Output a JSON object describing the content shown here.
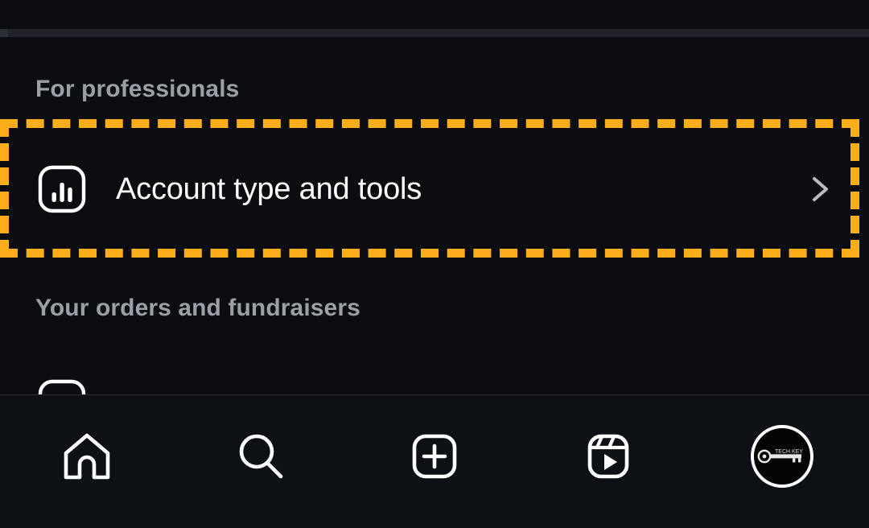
{
  "app": {
    "theme": "dark",
    "background_color": "#0b0d10",
    "accent_highlight_color": "#FBAD1B"
  },
  "sections": [
    {
      "heading": "For professionals"
    },
    {
      "heading": "Your orders and fundraisers"
    }
  ],
  "highlighted_row": {
    "label": "Account type and tools",
    "icon": "bar-chart-icon",
    "chevron": "chevron-right-icon",
    "annotation": {
      "style": "dashed-rectangle",
      "color": "#FBAD1B"
    }
  },
  "bottom_nav": {
    "items": [
      {
        "name": "home",
        "icon": "home-icon",
        "label": "Home"
      },
      {
        "name": "search",
        "icon": "search-icon",
        "label": "Search"
      },
      {
        "name": "create",
        "icon": "plus-square-icon",
        "label": "Create"
      },
      {
        "name": "reels",
        "icon": "reels-icon",
        "label": "Reels"
      },
      {
        "name": "profile",
        "icon": "avatar-icon",
        "label": "Profile"
      }
    ],
    "avatar_logo_text": "TECH KEY"
  }
}
